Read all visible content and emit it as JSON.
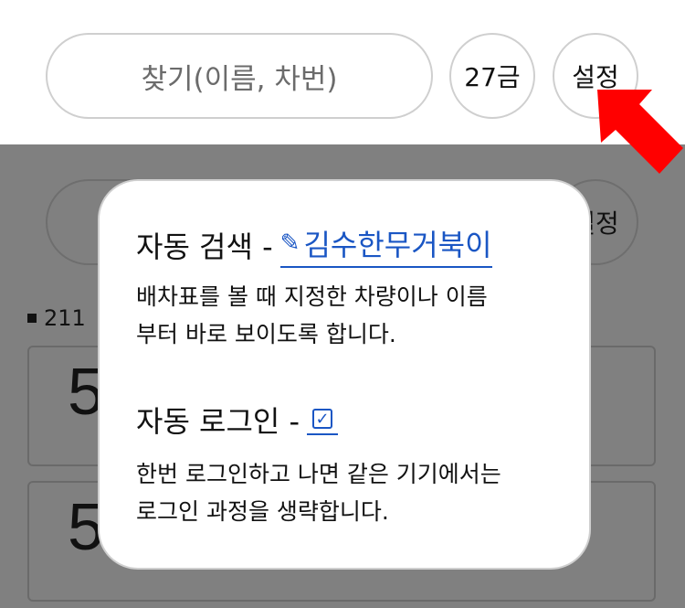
{
  "header": {
    "search_placeholder": "찾기(이름, 차번)",
    "day_button": "27금",
    "settings_button": "설정"
  },
  "background": {
    "settings_button": "설정",
    "section_label": "211",
    "cards": [
      {
        "number": "5"
      },
      {
        "number": "5"
      }
    ]
  },
  "popup": {
    "auto_search": {
      "title": "자동 검색 -",
      "icon": "pencil-icon",
      "link_text": "김수한무거북이",
      "description_line1": "배차표를 볼 때 지정한 차량이나 이름",
      "description_line2": "부터 바로 보이도록 합니다."
    },
    "auto_login": {
      "title": "자동 로그인 -",
      "checked": true,
      "description_line1": "한번 로그인하고 나면 같은 기기에서는",
      "description_line2": "로그인 과정을 생략합니다."
    }
  },
  "colors": {
    "accent": "#1a56c4",
    "overlay": "#808080",
    "arrow": "#ff0000"
  }
}
